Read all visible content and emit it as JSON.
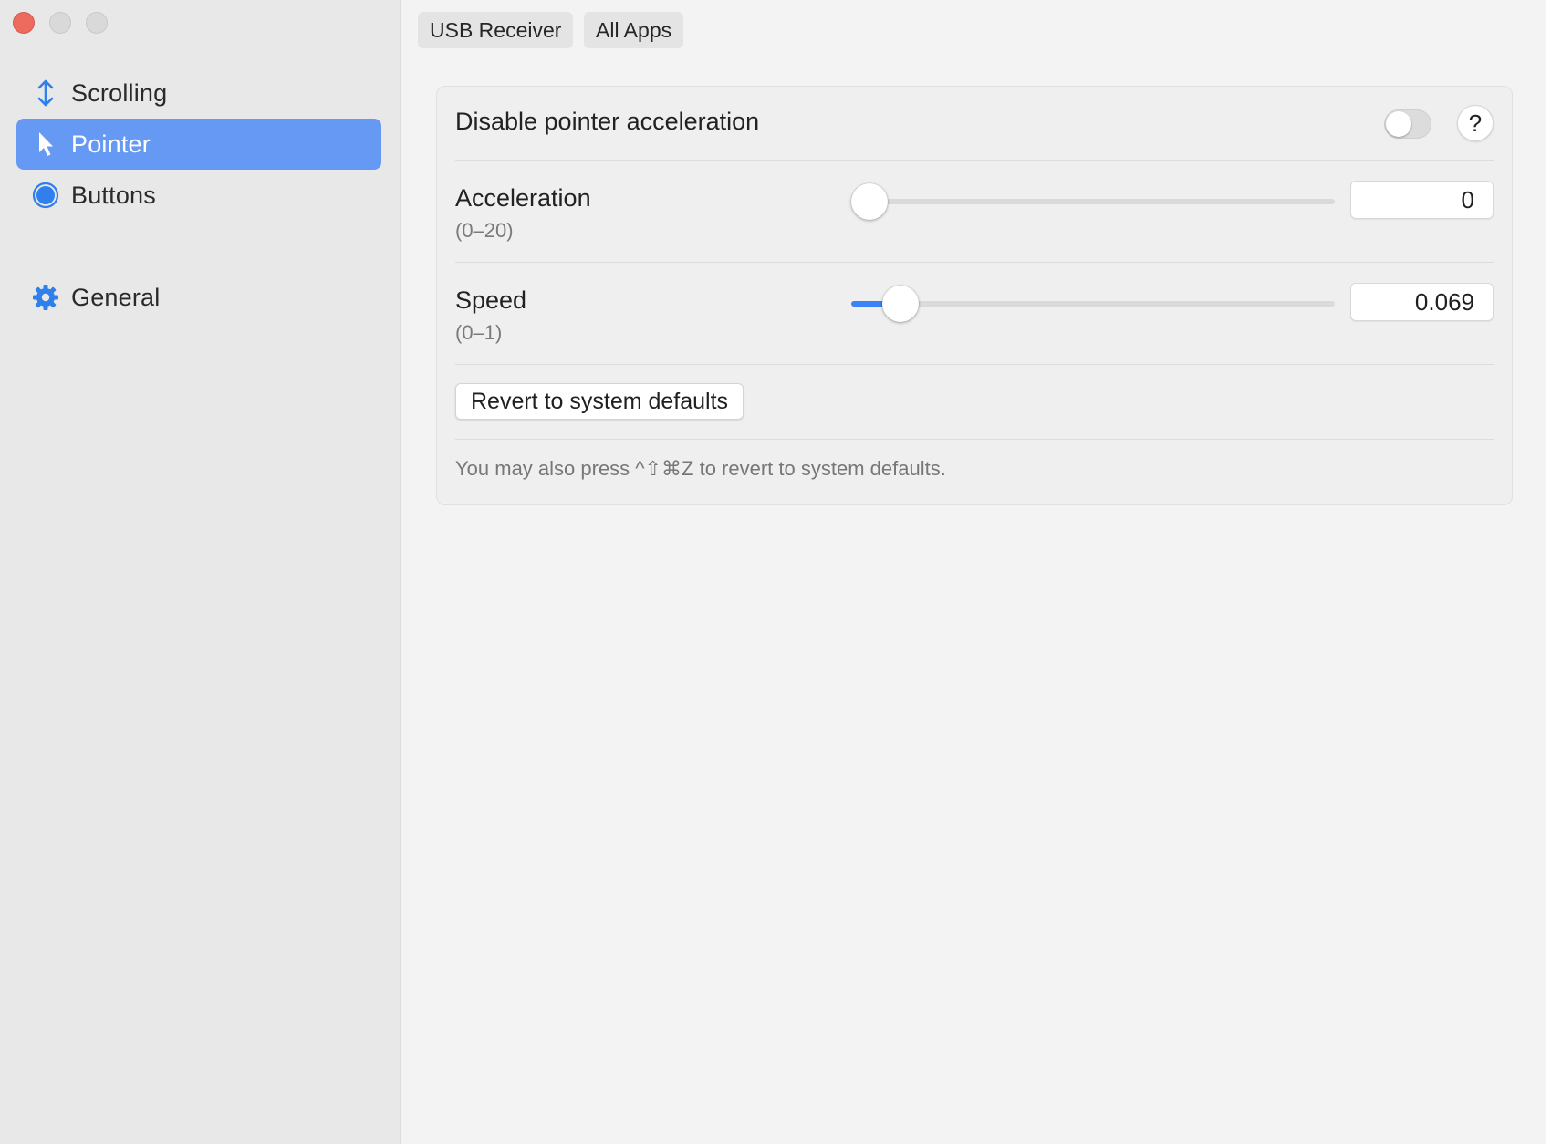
{
  "window": {
    "controls": [
      "close",
      "minimize",
      "zoom"
    ]
  },
  "sidebar": {
    "items": [
      {
        "label": "Scrolling",
        "icon": "vertical-arrows-icon",
        "selected": false
      },
      {
        "label": "Pointer",
        "icon": "pointer-arrow-icon",
        "selected": true
      },
      {
        "label": "Buttons",
        "icon": "filled-circle-icon",
        "selected": false
      },
      {
        "label": "General",
        "icon": "gear-icon",
        "selected": false
      }
    ]
  },
  "toolbar": {
    "device_label": "USB Receiver",
    "apps_label": "All Apps"
  },
  "pointer": {
    "disable_accel": {
      "label": "Disable pointer acceleration",
      "enabled": false,
      "help_label": "?"
    },
    "acceleration": {
      "label": "Acceleration",
      "range": "(0–20)",
      "value": "0",
      "min": 0,
      "max": 20
    },
    "speed": {
      "label": "Speed",
      "range": "(0–1)",
      "value": "0.069",
      "min": 0,
      "max": 1
    },
    "revert_label": "Revert to system defaults",
    "hint": "You may also press ^⇧⌘Z to revert to system defaults."
  },
  "colors": {
    "accent": "#3b82f6",
    "sidebar_selected": "#6699f3",
    "close_button": "#ed6a5e"
  }
}
